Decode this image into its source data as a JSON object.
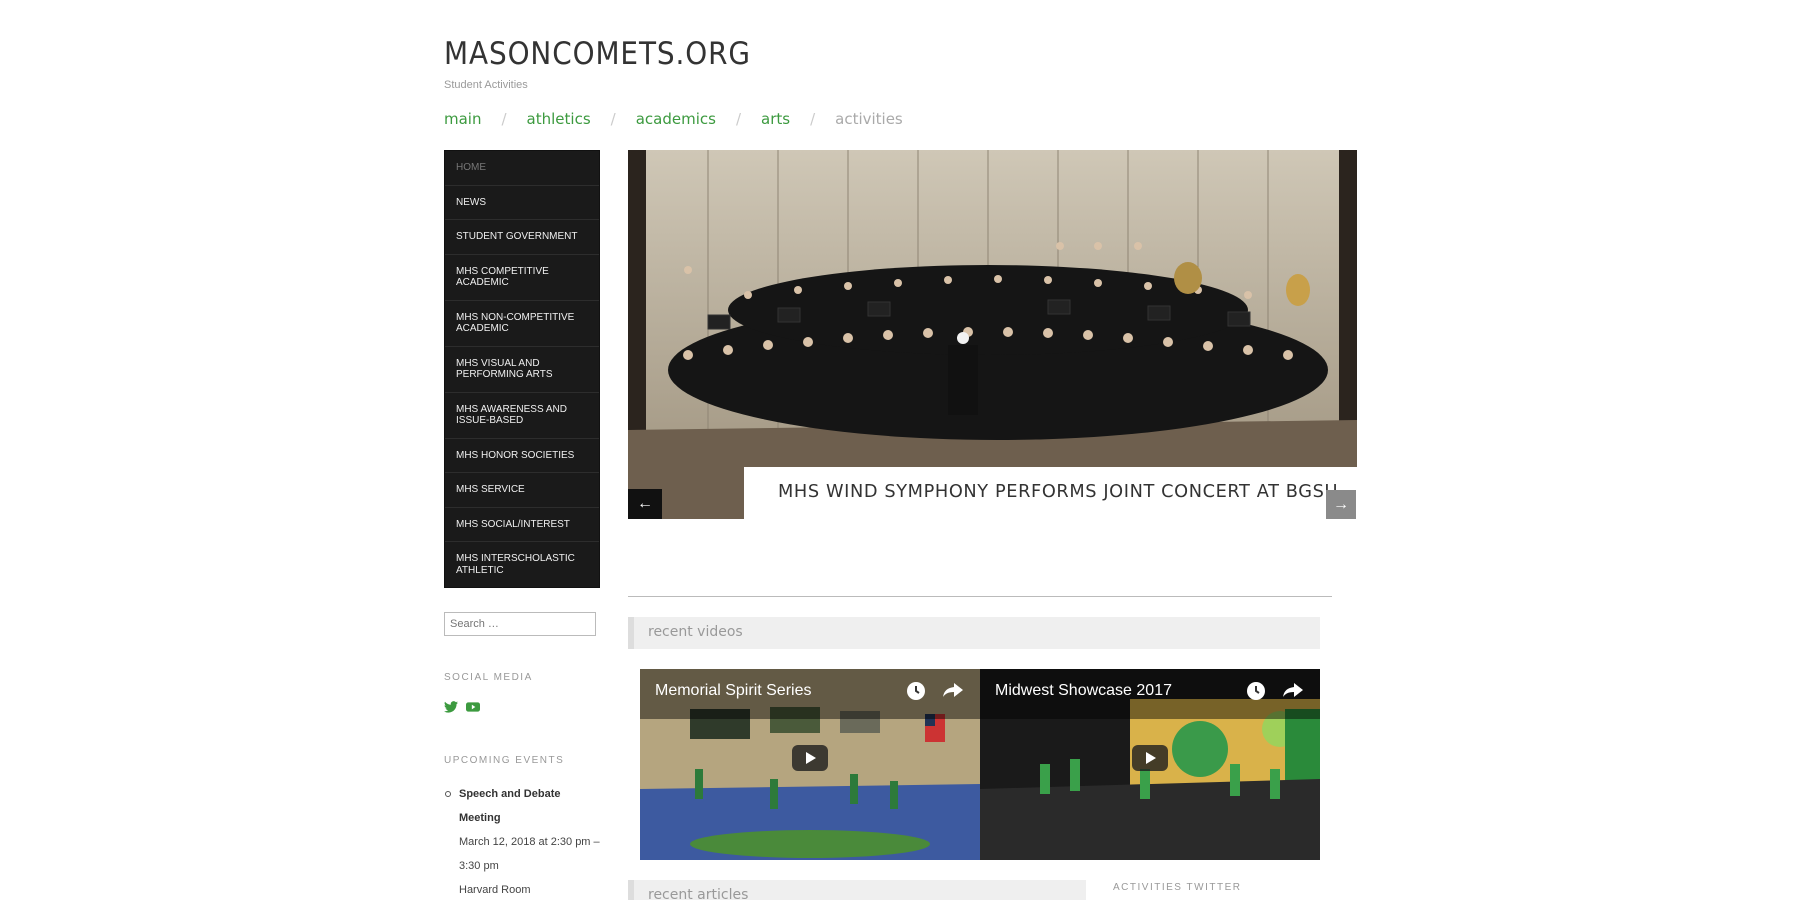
{
  "header": {
    "site_title": "MASONCOMETS.ORG",
    "site_description": "Student Activities"
  },
  "topnav": {
    "items": [
      {
        "label": "main",
        "current": false
      },
      {
        "label": "athletics",
        "current": false
      },
      {
        "label": "academics",
        "current": false
      },
      {
        "label": "arts",
        "current": false
      },
      {
        "label": "activities",
        "current": true
      }
    ],
    "separator": "/"
  },
  "sidebar": {
    "items": [
      {
        "label": "HOME"
      },
      {
        "label": "NEWS"
      },
      {
        "label": "STUDENT GOVERNMENT"
      },
      {
        "label": "MHS COMPETITIVE ACADEMIC"
      },
      {
        "label": "MHS NON-COMPETITIVE ACADEMIC"
      },
      {
        "label": "MHS VISUAL AND PERFORMING ARTS"
      },
      {
        "label": "MHS AWARENESS AND ISSUE-BASED"
      },
      {
        "label": "MHS HONOR SOCIETIES"
      },
      {
        "label": "MHS SERVICE"
      },
      {
        "label": "MHS SOCIAL/INTEREST"
      },
      {
        "label": "MHS INTERSCHOLASTIC ATHLETIC"
      }
    ],
    "search_placeholder": "Search …",
    "social_title": "SOCIAL MEDIA",
    "social_icons": [
      "twitter-icon",
      "youtube-icon"
    ],
    "events_title": "UPCOMING EVENTS",
    "events": [
      {
        "title": "Speech and Debate Meeting",
        "date": "March 12, 2018 at 2:30 pm – 3:30 pm",
        "location": "Harvard Room"
      }
    ]
  },
  "slider": {
    "caption": "MHS WIND SYMPHONY PERFORMS JOINT CONCERT AT BGSU",
    "prev_label": "←",
    "next_label": "→"
  },
  "main": {
    "recent_videos_title": "recent videos",
    "videos": [
      {
        "title": "Memorial Spirit Series"
      },
      {
        "title": "Midwest Showcase 2017"
      }
    ],
    "recent_articles_title": "recent articles",
    "twitter_title": "ACTIVITIES TWITTER"
  },
  "colors": {
    "accent_green": "#3c9a3f",
    "sidebar_bg": "#1a1a1a"
  }
}
